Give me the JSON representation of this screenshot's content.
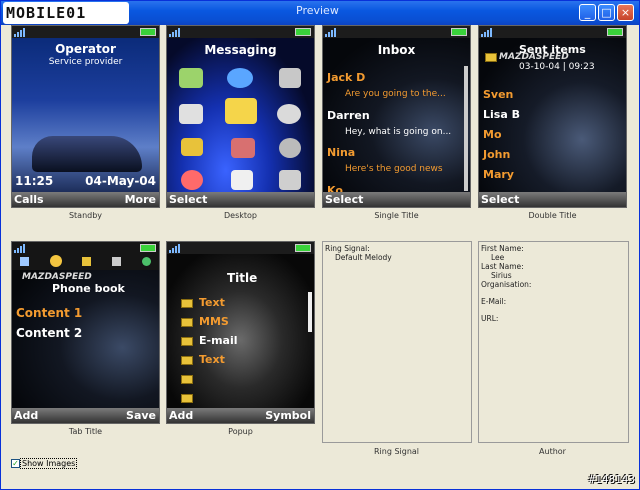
{
  "window": {
    "title": "Preview",
    "min": "_",
    "max": "□",
    "close": "×"
  },
  "watermark": "MOBILE01",
  "panels": {
    "standby": {
      "operator": "Operator",
      "provider": "Service provider",
      "time": "11:25",
      "date": "04-May-04",
      "left": "Calls",
      "right": "More",
      "caption": "Standby"
    },
    "desktop": {
      "title": "Messaging",
      "left": "Select",
      "caption": "Desktop"
    },
    "single": {
      "title": "Inbox",
      "items": [
        {
          "name": "Jack D",
          "msg": "Are you going to the..."
        },
        {
          "name": "Darren",
          "msg": "Hey, what is going on..."
        },
        {
          "name": "Nina",
          "msg": "Here's the good news"
        },
        {
          "name": "Ko",
          "msg": ""
        }
      ],
      "left": "Select",
      "caption": "Single Title"
    },
    "double": {
      "title": "Sent items",
      "subtitle": "03-10-04 | 09:23",
      "names": [
        "Sven",
        "Lisa B",
        "Mo",
        "John",
        "Mary"
      ],
      "left": "Select",
      "caption": "Double Title"
    },
    "tab": {
      "title": "Phone book",
      "items": [
        "Content 1",
        "Content 2"
      ],
      "left": "Add",
      "right": "Save",
      "caption": "Tab Title"
    },
    "popup": {
      "title": "Title",
      "items": [
        "Text",
        "MMS",
        "E-mail",
        "Text",
        "",
        ""
      ],
      "left": "Add",
      "right": "Symbol",
      "caption": "Popup"
    },
    "ring": {
      "label": "Ring Signal:",
      "value": "Default Melody",
      "caption": "Ring Signal"
    },
    "author": {
      "first_label": "First Name:",
      "first": "Lee",
      "last_label": "Last Name:",
      "last": "Sirius",
      "org_label": "Organisation:",
      "email_label": "E-Mail:",
      "url_label": "URL:",
      "caption": "Author"
    }
  },
  "show_images": {
    "label": "Show Images",
    "checked": "✓"
  },
  "badge": "#148143",
  "logo_text": "MAZDASPEED"
}
